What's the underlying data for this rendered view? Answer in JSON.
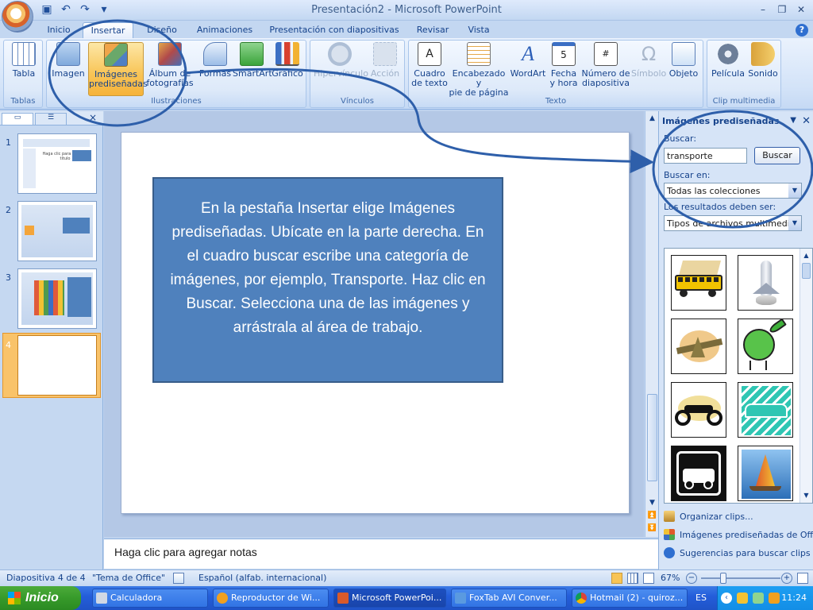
{
  "window": {
    "title": "Presentación2 - Microsoft PowerPoint",
    "minimize_glyph": "–",
    "restore_glyph": "❐",
    "close_glyph": "✕"
  },
  "quick_access": {
    "icons": [
      "save-icon",
      "undo-icon",
      "redo-icon",
      "customize-icon"
    ]
  },
  "tabs": [
    "Inicio",
    "Insertar",
    "Diseño",
    "Animaciones",
    "Presentación con diapositivas",
    "Revisar",
    "Vista"
  ],
  "active_tab": "Insertar",
  "ribbon": {
    "groups": {
      "tablas": "Tablas",
      "ilustraciones": "Ilustraciones",
      "vinculos": "Vínculos",
      "texto": "Texto",
      "clip": "Clip multimedia"
    },
    "buttons": {
      "tabla": "Tabla",
      "imagen": "Imagen",
      "imagenes_pred_1": "Imágenes",
      "imagenes_pred_2": "prediseñadas",
      "album_1": "Álbum de",
      "album_2": "fotografías",
      "formas": "Formas",
      "smartart": "SmartArt",
      "grafico": "Gráfico",
      "hipervinculo": "Hipervínculo",
      "accion": "Acción",
      "cuadro_1": "Cuadro",
      "cuadro_2": "de texto",
      "encabezado_1": "Encabezado y",
      "encabezado_2": "pie de página",
      "wordart": "WordArt",
      "fecha_1": "Fecha",
      "fecha_2": "y hora",
      "numero_1": "Número de",
      "numero_2": "diapositiva",
      "simbolo": "Símbolo",
      "objeto": "Objeto",
      "pelicula": "Película",
      "sonido": "Sonido"
    },
    "colors": {
      "selected": "#f8c456",
      "ribbon_bg": "#dde9f9"
    }
  },
  "slides_panel": {
    "slide_numbers": [
      "1",
      "2",
      "3",
      "4"
    ],
    "current_slide": "4",
    "thumb1_text": "Haga clic para agregar título"
  },
  "slide": {
    "callout_text": "En la pestaña Insertar elige Imágenes prediseñadas. Ubícate en la parte derecha. En el cuadro buscar escribe una categoría de imágenes, por ejemplo, Transporte. Haz clic en Buscar. Selecciona una de las imágenes y arrástrala al área de trabajo.",
    "callout_color": "#4f81bd"
  },
  "notes": {
    "placeholder": "Haga clic para agregar notas"
  },
  "task_pane": {
    "title": "Imágenes prediseñadas",
    "search_label": "Buscar:",
    "search_value": "transporte",
    "search_button": "Buscar",
    "search_in_label": "Buscar en:",
    "search_in_value": "Todas las colecciones",
    "results_label": "Los resultados deben ser:",
    "results_value": "Tipos de archivos multimedia se",
    "clips": [
      "bus-clip",
      "space-shuttle-clip",
      "airplane-clip",
      "globe-rocket-clip",
      "motorcycle-clip",
      "taxi-clip",
      "tow-truck-clip",
      "sailboat-clip"
    ],
    "links": [
      "Organizar clips...",
      "Imágenes prediseñadas de Office",
      "Sugerencias para buscar clips"
    ]
  },
  "status": {
    "slide_info": "Diapositiva 4 de 4",
    "theme": "\"Tema de Office\"",
    "language": "Español (alfab. internacional)",
    "zoom": "67%",
    "zoom_level": 0.67
  },
  "taskbar": {
    "start_label": "Inicio",
    "tasks": [
      "Calculadora",
      "Reproductor de Wi...",
      "Microsoft PowerPoi...",
      "FoxTab AVI Conver...",
      "Hotmail (2) - quiroz..."
    ],
    "active_task": "Microsoft PowerPoi...",
    "lang": "ES",
    "clock": "11:24"
  },
  "annotation": {
    "stroke_color": "#2e5faa"
  }
}
